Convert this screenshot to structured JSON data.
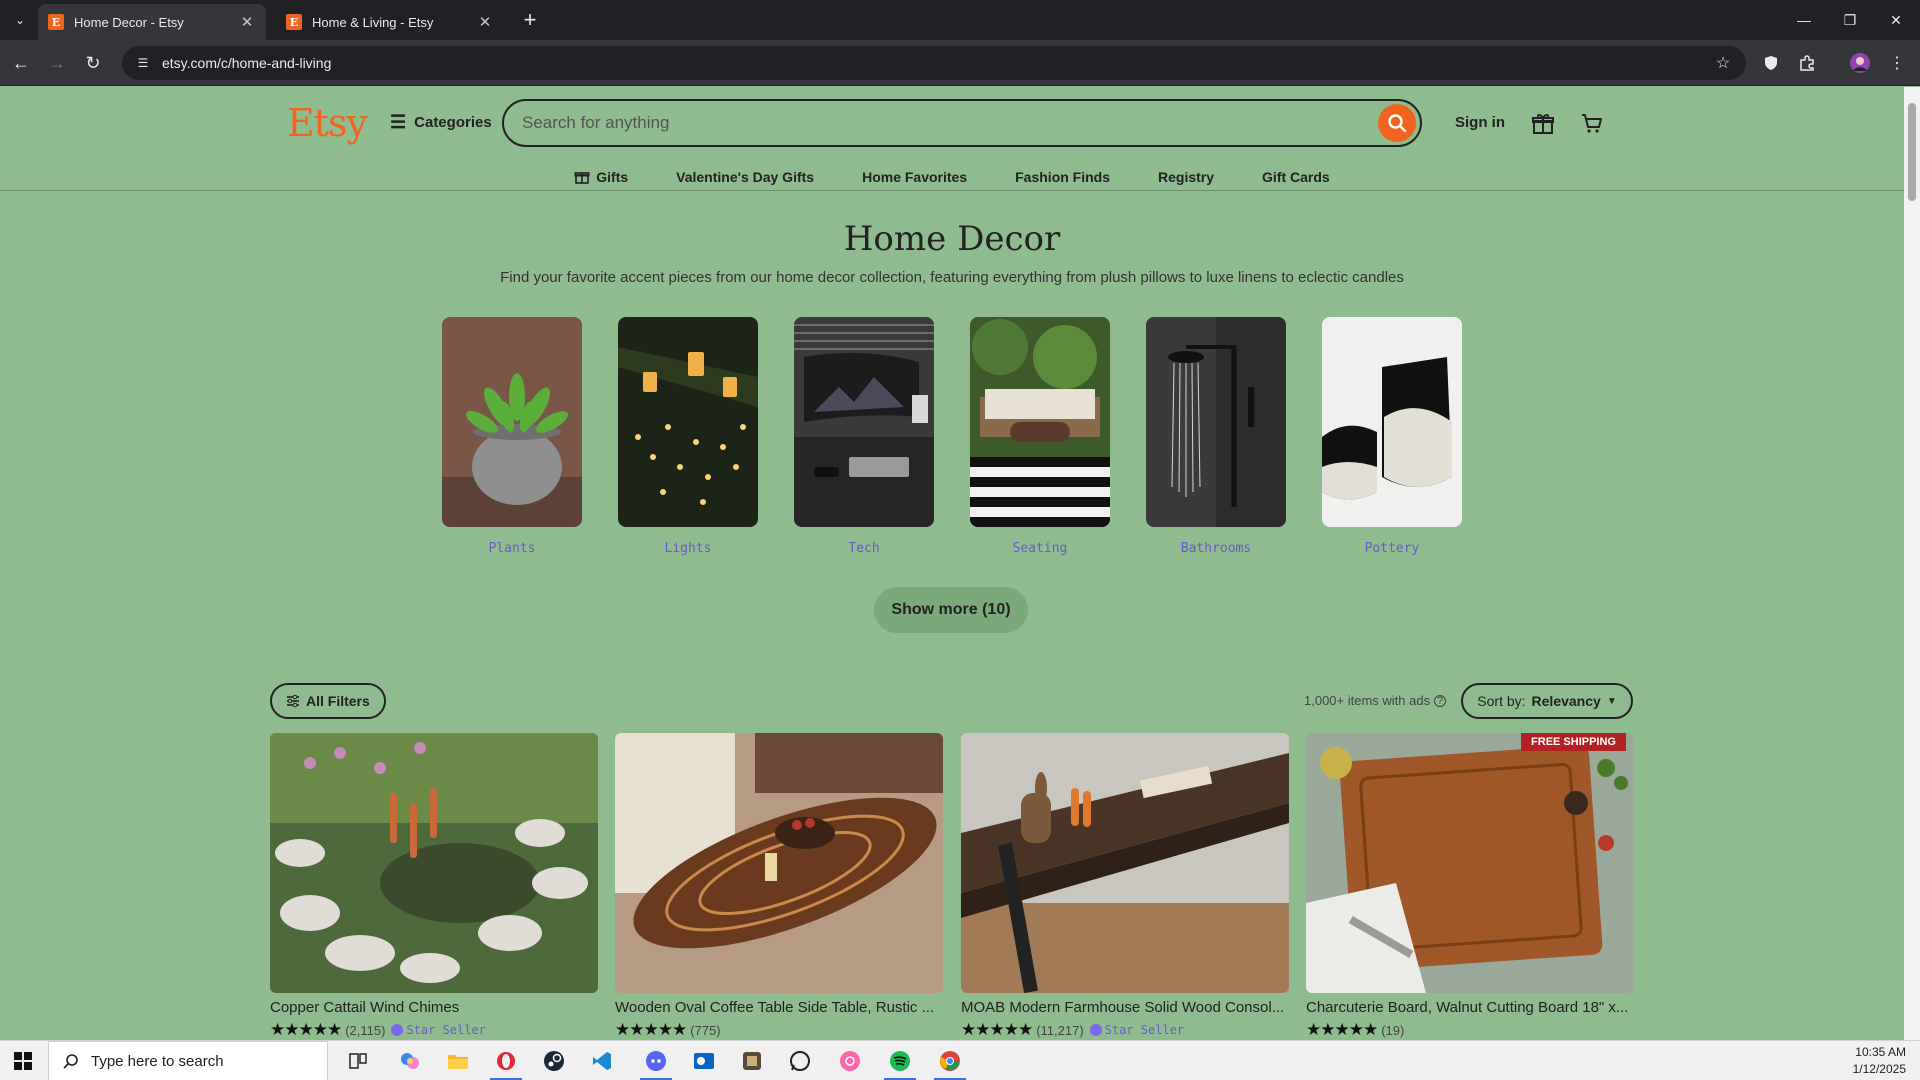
{
  "browser": {
    "tabs": [
      {
        "title": "Home Decor - Etsy",
        "active": true
      },
      {
        "title": "Home & Living - Etsy",
        "active": false
      }
    ],
    "url": "etsy.com/c/home-and-living"
  },
  "header": {
    "logo": "Etsy",
    "categories_label": "Categories",
    "search_placeholder": "Search for anything",
    "signin_label": "Sign in"
  },
  "subnav": [
    "Gifts",
    "Valentine's Day Gifts",
    "Home Favorites",
    "Fashion Finds",
    "Registry",
    "Gift Cards"
  ],
  "hero": {
    "title": "Home Decor",
    "lede": "Find your favorite accent pieces from our home decor collection, featuring everything from plush pillows to luxe linens to eclectic candles"
  },
  "categories": [
    {
      "label": "Plants"
    },
    {
      "label": "Lights"
    },
    {
      "label": "Tech"
    },
    {
      "label": "Seating"
    },
    {
      "label": "Bathrooms"
    },
    {
      "label": "Pottery"
    }
  ],
  "show_more_label": "Show more (10)",
  "filters": {
    "all_filters_label": "All Filters",
    "results_count": "1,000+ items with ads",
    "sort_prefix": "Sort by:",
    "sort_value": "Relevancy"
  },
  "listings": [
    {
      "title": "Copper Cattail Wind Chimes",
      "stars": "★★★★★",
      "reviews": "(2,115)",
      "star_seller": "Star Seller"
    },
    {
      "title": "Wooden Oval Coffee Table Side Table, Rustic ...",
      "stars": "★★★★★",
      "reviews": "(775)",
      "star_seller": ""
    },
    {
      "title": "MOAB Modern Farmhouse Solid Wood Consol...",
      "stars": "★★★★★",
      "reviews": "(11,217)",
      "star_seller": "Star Seller"
    },
    {
      "title": "Charcuterie Board, Walnut Cutting Board 18\" x...",
      "stars": "★★★★★",
      "reviews": "(19)",
      "star_seller": "",
      "badge": "FREE SHIPPING"
    }
  ],
  "taskbar": {
    "search_placeholder": "Type here to search",
    "time": "10:35 AM",
    "date": "1/12/2025"
  },
  "colors": {
    "page_bg": "#8ebc8e",
    "etsy_orange": "#f1641e",
    "link_purple": "#6a5acd"
  }
}
